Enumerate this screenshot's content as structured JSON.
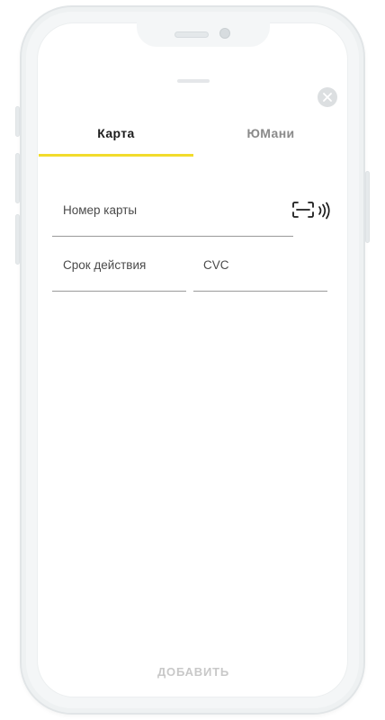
{
  "tabs": {
    "card_label": "Карта",
    "ymoney_label": "ЮМани",
    "active": "card"
  },
  "form": {
    "card_number_label": "Номер карты",
    "expiry_label": "Срок действия",
    "cvc_label": "CVC"
  },
  "actions": {
    "add_label": "ДОБАВИТЬ"
  },
  "icons": {
    "close": "close-icon",
    "scan": "scan-card-icon",
    "nfc": "nfc-icon"
  },
  "colors": {
    "accent": "#f2dc2c",
    "text": "#1c1c1c",
    "muted": "#8a8a8a",
    "disabled": "#c8c8c8"
  }
}
